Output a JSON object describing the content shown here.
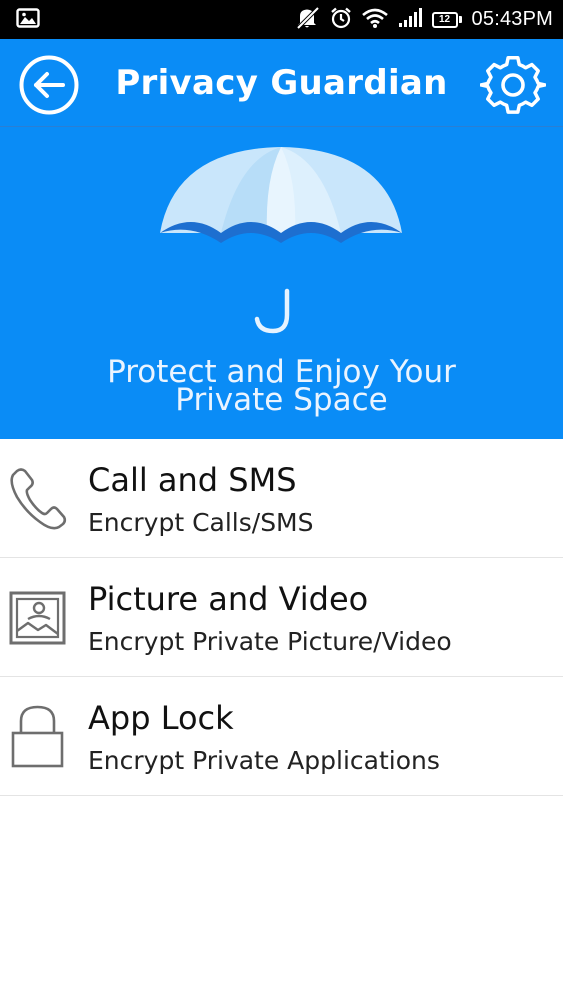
{
  "status_bar": {
    "time": "05:43PM",
    "battery_level": "12",
    "icons": [
      "image-notification-icon",
      "muted-icon",
      "alarm-icon",
      "wifi-icon",
      "signal-icon",
      "battery-icon"
    ]
  },
  "app_bar": {
    "title": "Privacy Guardian",
    "back_icon": "back-arrow-circle-icon",
    "settings_icon": "gear-icon"
  },
  "hero": {
    "line_1": "Protect and Enjoy Your",
    "line_2": "Private Space",
    "illustration": "umbrella-icon"
  },
  "features": [
    {
      "icon": "phone-icon",
      "title": "Call and SMS",
      "subtitle": "Encrypt Calls/SMS"
    },
    {
      "icon": "picture-icon",
      "title": "Picture and Video",
      "subtitle": "Encrypt Private Picture/Video"
    },
    {
      "icon": "lock-icon",
      "title": "App Lock",
      "subtitle": "Encrypt Private Applications"
    }
  ],
  "colors": {
    "primary": "#0a8cf6",
    "status_bar": "#000000",
    "hero_text": "#eaf4ff",
    "icon_gray": "#6e6e6e",
    "divider": "#e4e4e4"
  }
}
